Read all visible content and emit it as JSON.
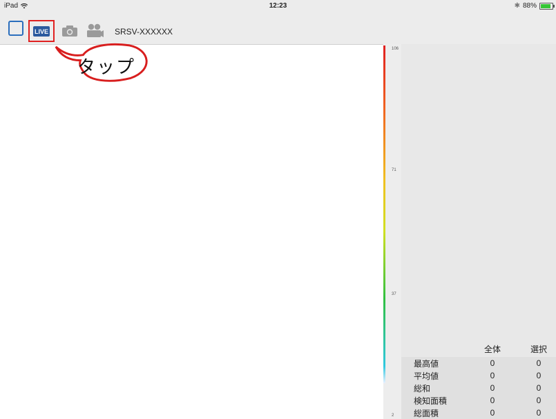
{
  "status_bar": {
    "device": "iPad",
    "time": "12:23",
    "battery": "88%",
    "battery_level": 0.88
  },
  "toolbar": {
    "live_label": "LIVE",
    "device_name": "SRSV-XXXXXX"
  },
  "callout": {
    "text": "タップ"
  },
  "scale": {
    "ticks": [
      "106",
      "71",
      "37",
      "2"
    ]
  },
  "stats": {
    "headers": [
      "",
      "全体",
      "選択"
    ],
    "rows": [
      {
        "label": "最高値",
        "all": "0",
        "selected": "0"
      },
      {
        "label": "平均値",
        "all": "0",
        "selected": "0"
      },
      {
        "label": "総和",
        "all": "0",
        "selected": "0"
      },
      {
        "label": "検知面積",
        "all": "0",
        "selected": "0"
      },
      {
        "label": "総面積",
        "all": "0",
        "selected": "0"
      }
    ]
  },
  "colors": {
    "accent": "#2a6ebd",
    "live_bg": "#2b5a9e",
    "highlight": "#e02020"
  }
}
